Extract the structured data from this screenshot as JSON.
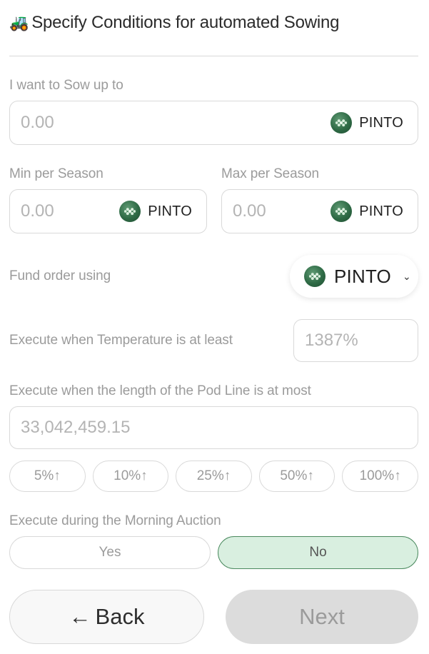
{
  "header": {
    "icon": "tractor-icon",
    "title": "Specify Conditions for automated Sowing"
  },
  "sow_amount": {
    "label": "I want to Sow up to",
    "placeholder": "0.00",
    "token": "PINTO"
  },
  "min_per_season": {
    "label": "Min per Season",
    "placeholder": "0.00",
    "token": "PINTO"
  },
  "max_per_season": {
    "label": "Max per Season",
    "placeholder": "0.00",
    "token": "PINTO"
  },
  "fund_order": {
    "label": "Fund order using",
    "selected_token": "PINTO"
  },
  "temperature": {
    "label": "Execute when Temperature is at least",
    "placeholder": "1387%"
  },
  "pod_line": {
    "label": "Execute when the length of the Pod Line is at most",
    "placeholder": "33,042,459.15",
    "increments": [
      "5%↑",
      "10%↑",
      "25%↑",
      "50%↑",
      "100%↑"
    ]
  },
  "morning_auction": {
    "label": "Execute during the Morning Auction",
    "yes_label": "Yes",
    "no_label": "No",
    "selected": "No"
  },
  "footer": {
    "back_label": "Back",
    "next_label": "Next"
  },
  "colors": {
    "accent_green": "#4b8a5f",
    "selected_bg": "#d9efe0",
    "coin_green": "#2e6a45"
  }
}
